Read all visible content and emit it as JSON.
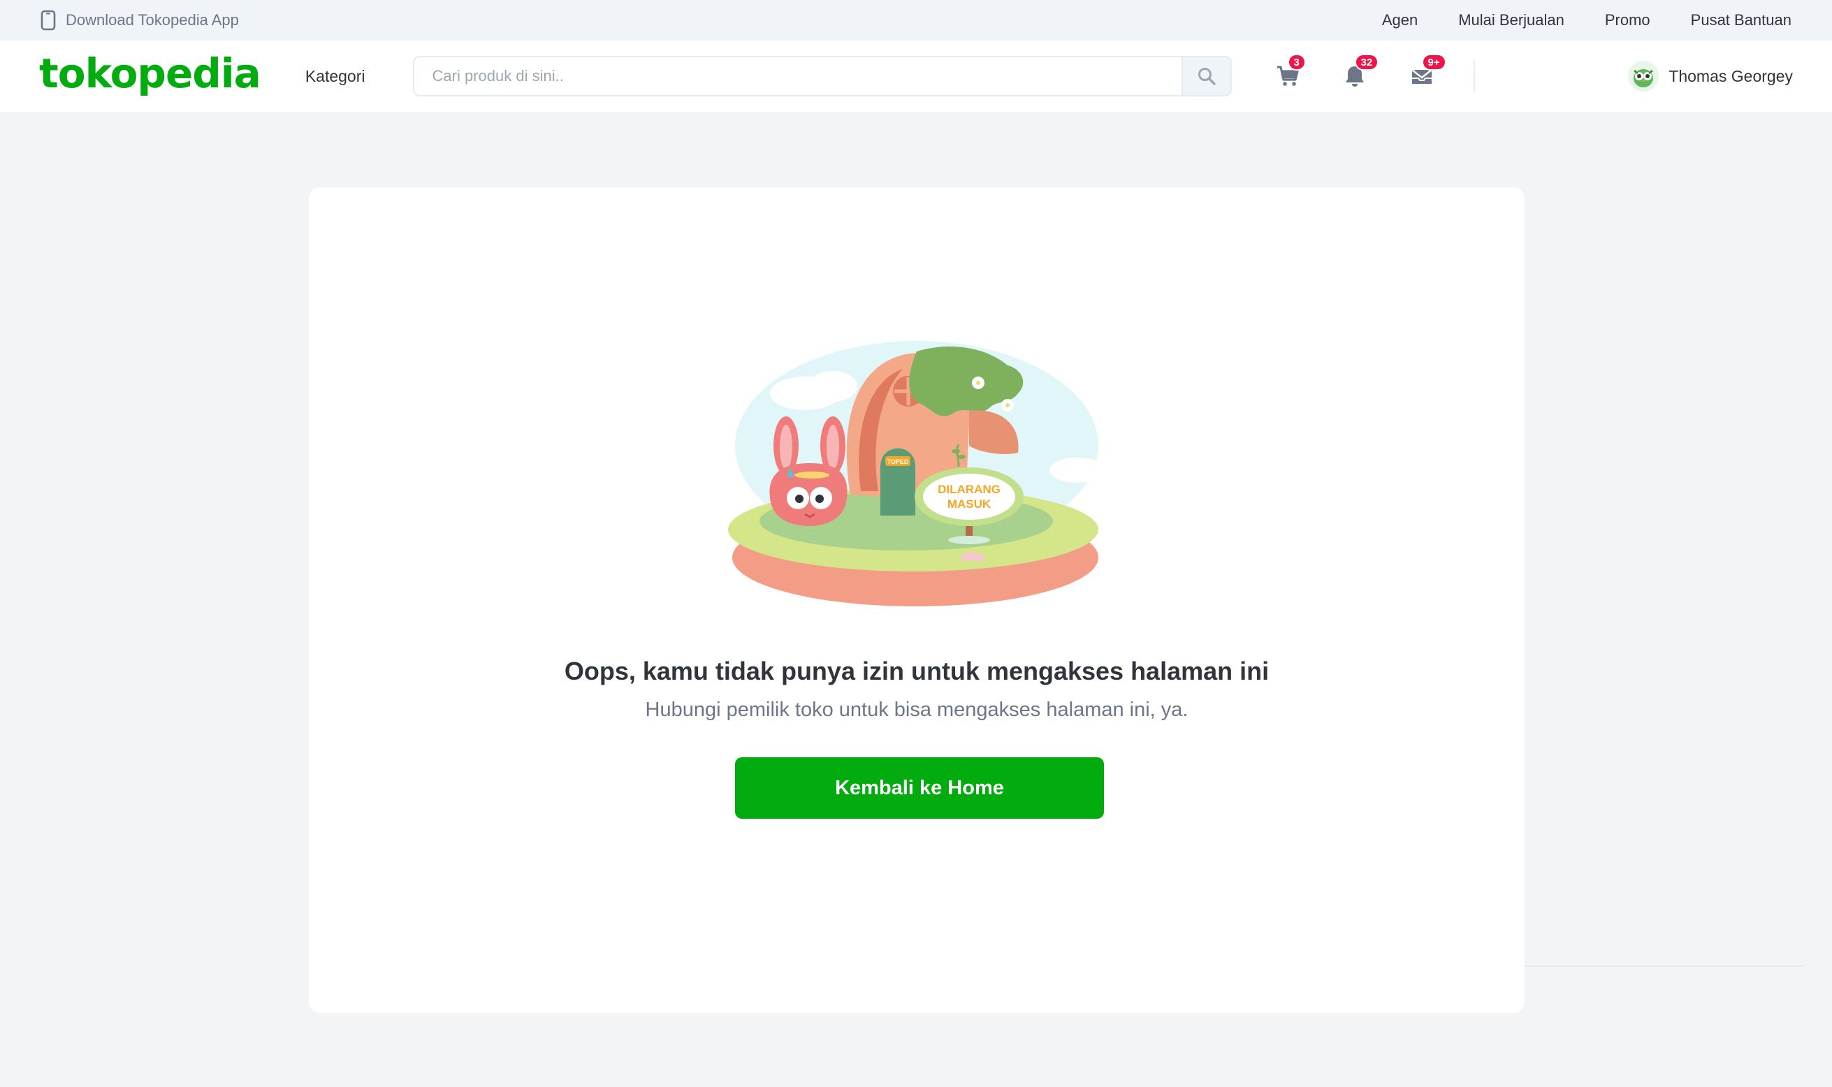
{
  "topbar": {
    "download_app": "Download Tokopedia App",
    "links": [
      "Agen",
      "Mulai Berjualan",
      "Promo",
      "Pusat Bantuan"
    ]
  },
  "header": {
    "logo": "tokopedia",
    "kategori": "Kategori",
    "search_placeholder": "Cari produk di sini..",
    "cart_badge": "3",
    "notif_badge": "32",
    "inbox_badge": "9+",
    "user_name": "Thomas Georgey"
  },
  "main": {
    "sign_line1": "DILARANG",
    "sign_line2": "MASUK",
    "door_label": "TOPED",
    "title": "Oops, kamu tidak punya izin untuk mengakses halaman ini",
    "subtitle": "Hubungi pemilik toko untuk bisa mengakses halaman ini, ya.",
    "home_button": "Kembali ke Home"
  },
  "colors": {
    "brand_green": "#03ac0e",
    "badge_red": "#ef144a"
  }
}
